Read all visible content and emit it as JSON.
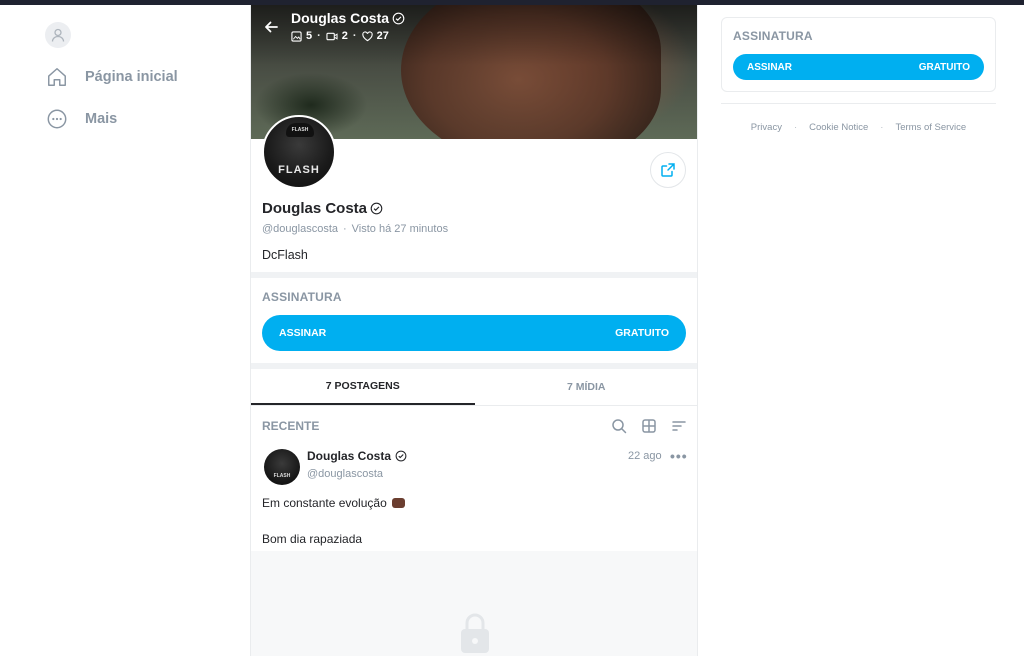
{
  "sidebar": {
    "items": [
      {
        "label": "Página inicial",
        "icon": "home-icon"
      },
      {
        "label": "Mais",
        "icon": "more-circle-icon"
      }
    ]
  },
  "profile": {
    "name": "Douglas Costa",
    "handle": "@douglascosta",
    "separator": "·",
    "last_seen": "Visto  há 27 minutos",
    "bio": "DcFlash",
    "avatar_text": "FLASH",
    "stats": {
      "photos": "5",
      "videos": "2",
      "likes": "27"
    }
  },
  "subscription": {
    "title": "ASSINATURA",
    "button_label": "ASSINAR",
    "button_price": "GRATUITO"
  },
  "tabs": [
    {
      "label": "7 POSTAGENS",
      "active": true
    },
    {
      "label": "7 MÍDIA",
      "active": false
    }
  ],
  "feed": {
    "section_label": "RECENTE"
  },
  "post": {
    "author": "Douglas Costa",
    "handle": "@douglascosta",
    "time": "22 ago",
    "more": "•••",
    "text_line1": "Em constante evolução",
    "text_line2": "Bom dia rapaziada"
  },
  "right": {
    "subscription": {
      "title": "ASSINATURA",
      "button_label": "ASSINAR",
      "button_price": "GRATUITO"
    },
    "footer": {
      "dot": "·",
      "links": [
        "Privacy",
        "Cookie Notice",
        "Terms of Service"
      ]
    }
  },
  "colors": {
    "accent": "#00aff0",
    "muted": "#8a96a3",
    "text": "#242529"
  }
}
